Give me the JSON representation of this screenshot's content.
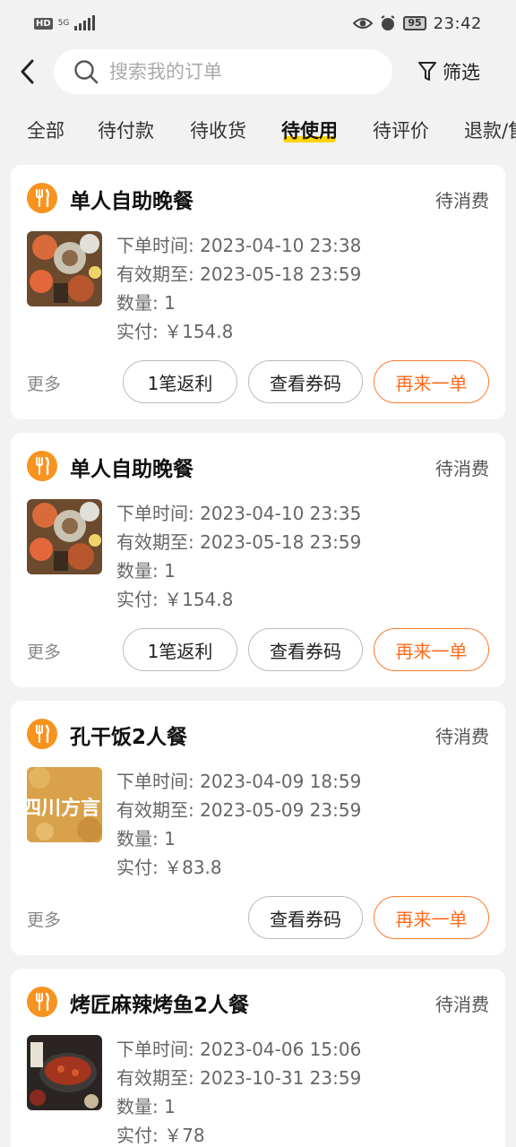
{
  "status_bar": {
    "hd": "HD",
    "network": "5G",
    "battery": "95",
    "time": "23:42"
  },
  "header": {
    "search_placeholder": "搜索我的订单",
    "filter_label": "筛选"
  },
  "tabs": [
    "全部",
    "待付款",
    "待收货",
    "待使用",
    "待评价",
    "退款/售后"
  ],
  "active_tab": "待使用",
  "labels": {
    "more": "更多",
    "rebate": "1笔返利",
    "view_code": "查看券码",
    "reorder": "再来一单"
  },
  "orders": [
    {
      "name": "单人自助晚餐",
      "status": "待消费",
      "order_time": "下单时间: 2023-04-10 23:38",
      "valid_until": "有效期至: 2023-05-18 23:59",
      "quantity": "数量: 1",
      "paid": "实付: ￥154.8"
    },
    {
      "name": "单人自助晚餐",
      "status": "待消费",
      "order_time": "下单时间: 2023-04-10 23:35",
      "valid_until": "有效期至: 2023-05-18 23:59",
      "quantity": "数量: 1",
      "paid": "实付: ￥154.8"
    },
    {
      "name": "孔干饭2人餐",
      "status": "待消费",
      "order_time": "下单时间: 2023-04-09 18:59",
      "valid_until": "有效期至: 2023-05-09 23:59",
      "quantity": "数量: 1",
      "paid": "实付: ￥83.8",
      "thumb_text": "四川方言"
    },
    {
      "name": "烤匠麻辣烤鱼2人餐",
      "status": "待消费",
      "order_time": "下单时间: 2023-04-06 15:06",
      "valid_until": "有效期至: 2023-10-31 23:59",
      "quantity": "数量: 1",
      "paid": "实付: ￥78"
    }
  ],
  "colors": {
    "accent_orange": "#f7931e",
    "button_orange": "#ff6a1a",
    "tab_underline": "#ffd400"
  }
}
